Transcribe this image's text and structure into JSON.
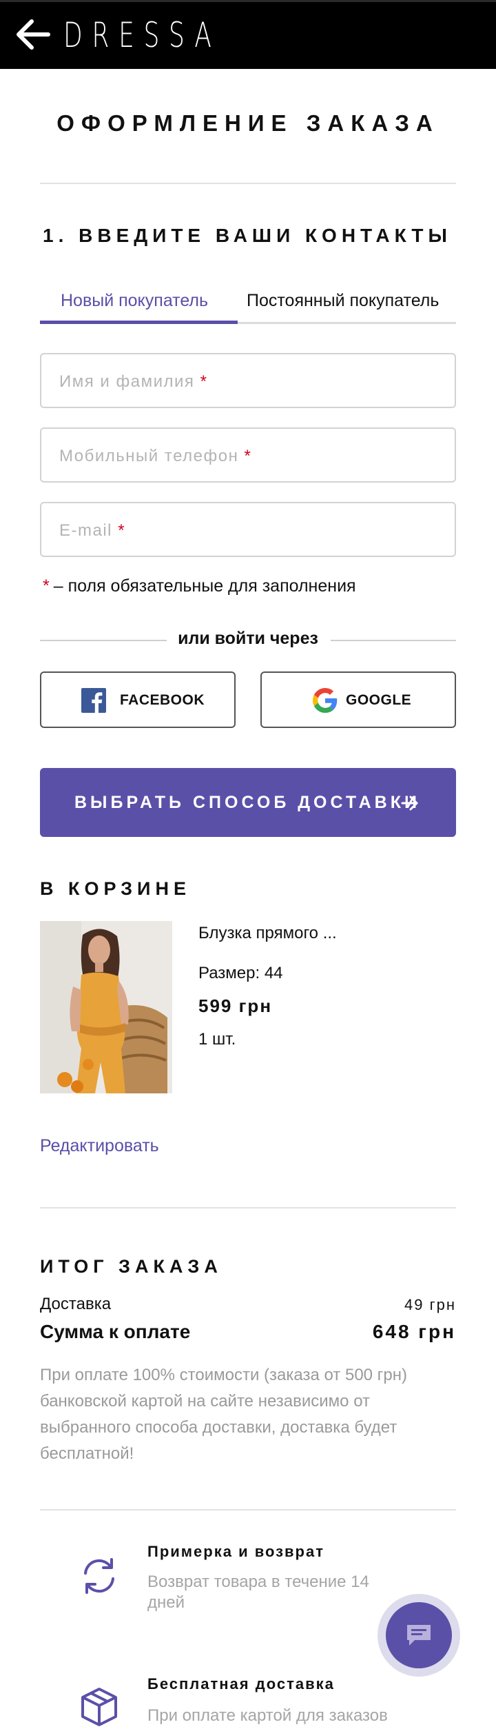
{
  "header": {
    "logo": "DRESSA"
  },
  "page_title": "ОФОРМЛЕНИЕ ЗАКАЗА",
  "contacts": {
    "title": "1. ВВЕДИТЕ ВАШИ КОНТАКТЫ",
    "tabs": [
      {
        "label": "Новый покупатель",
        "active": true
      },
      {
        "label": "Постоянный покупатель",
        "active": false
      }
    ],
    "fields": {
      "name": {
        "placeholder": "Имя и фамилия",
        "value": ""
      },
      "phone": {
        "placeholder": "Мобильный телефон",
        "value": ""
      },
      "email": {
        "placeholder": "E-mail",
        "value": ""
      }
    },
    "required_mark": "*",
    "required_note": "– поля обязательные для заполнения",
    "or_login": "или войти через",
    "facebook_label": "FACEBOOK",
    "google_label": "GOOGLE",
    "submit_label": "ВЫБРАТЬ СПОСОБ ДОСТАВКИ"
  },
  "cart": {
    "title": "В КОРЗИНЕ",
    "item": {
      "name": "Блузка прямого ...",
      "size": "Размер: 44",
      "price": "599 грн",
      "quantity": "1 шт."
    },
    "edit_label": "Редактировать"
  },
  "summary": {
    "title": "ИТОГ ЗАКАЗА",
    "delivery_label": "Доставка",
    "delivery_value": "49 грн",
    "total_label": "Сумма к оплате",
    "total_value": "648 грн",
    "info": "При оплате 100% стоимости (заказа от 500 грн) банковской картой на сайте независимо от выбранного способа доставки, доставка будет бесплатной!"
  },
  "features": [
    {
      "icon": "refresh-icon",
      "title": "Примерка и возврат",
      "text": "Возврат товара в течение 14 дней"
    },
    {
      "icon": "box-icon",
      "title": "Бесплатная доставка",
      "text": "При оплате картой для заказов"
    }
  ],
  "colors": {
    "accent": "#5b50a8",
    "required": "#d0021b",
    "header_bg": "#000000",
    "muted_text": "#9a9a9a"
  }
}
